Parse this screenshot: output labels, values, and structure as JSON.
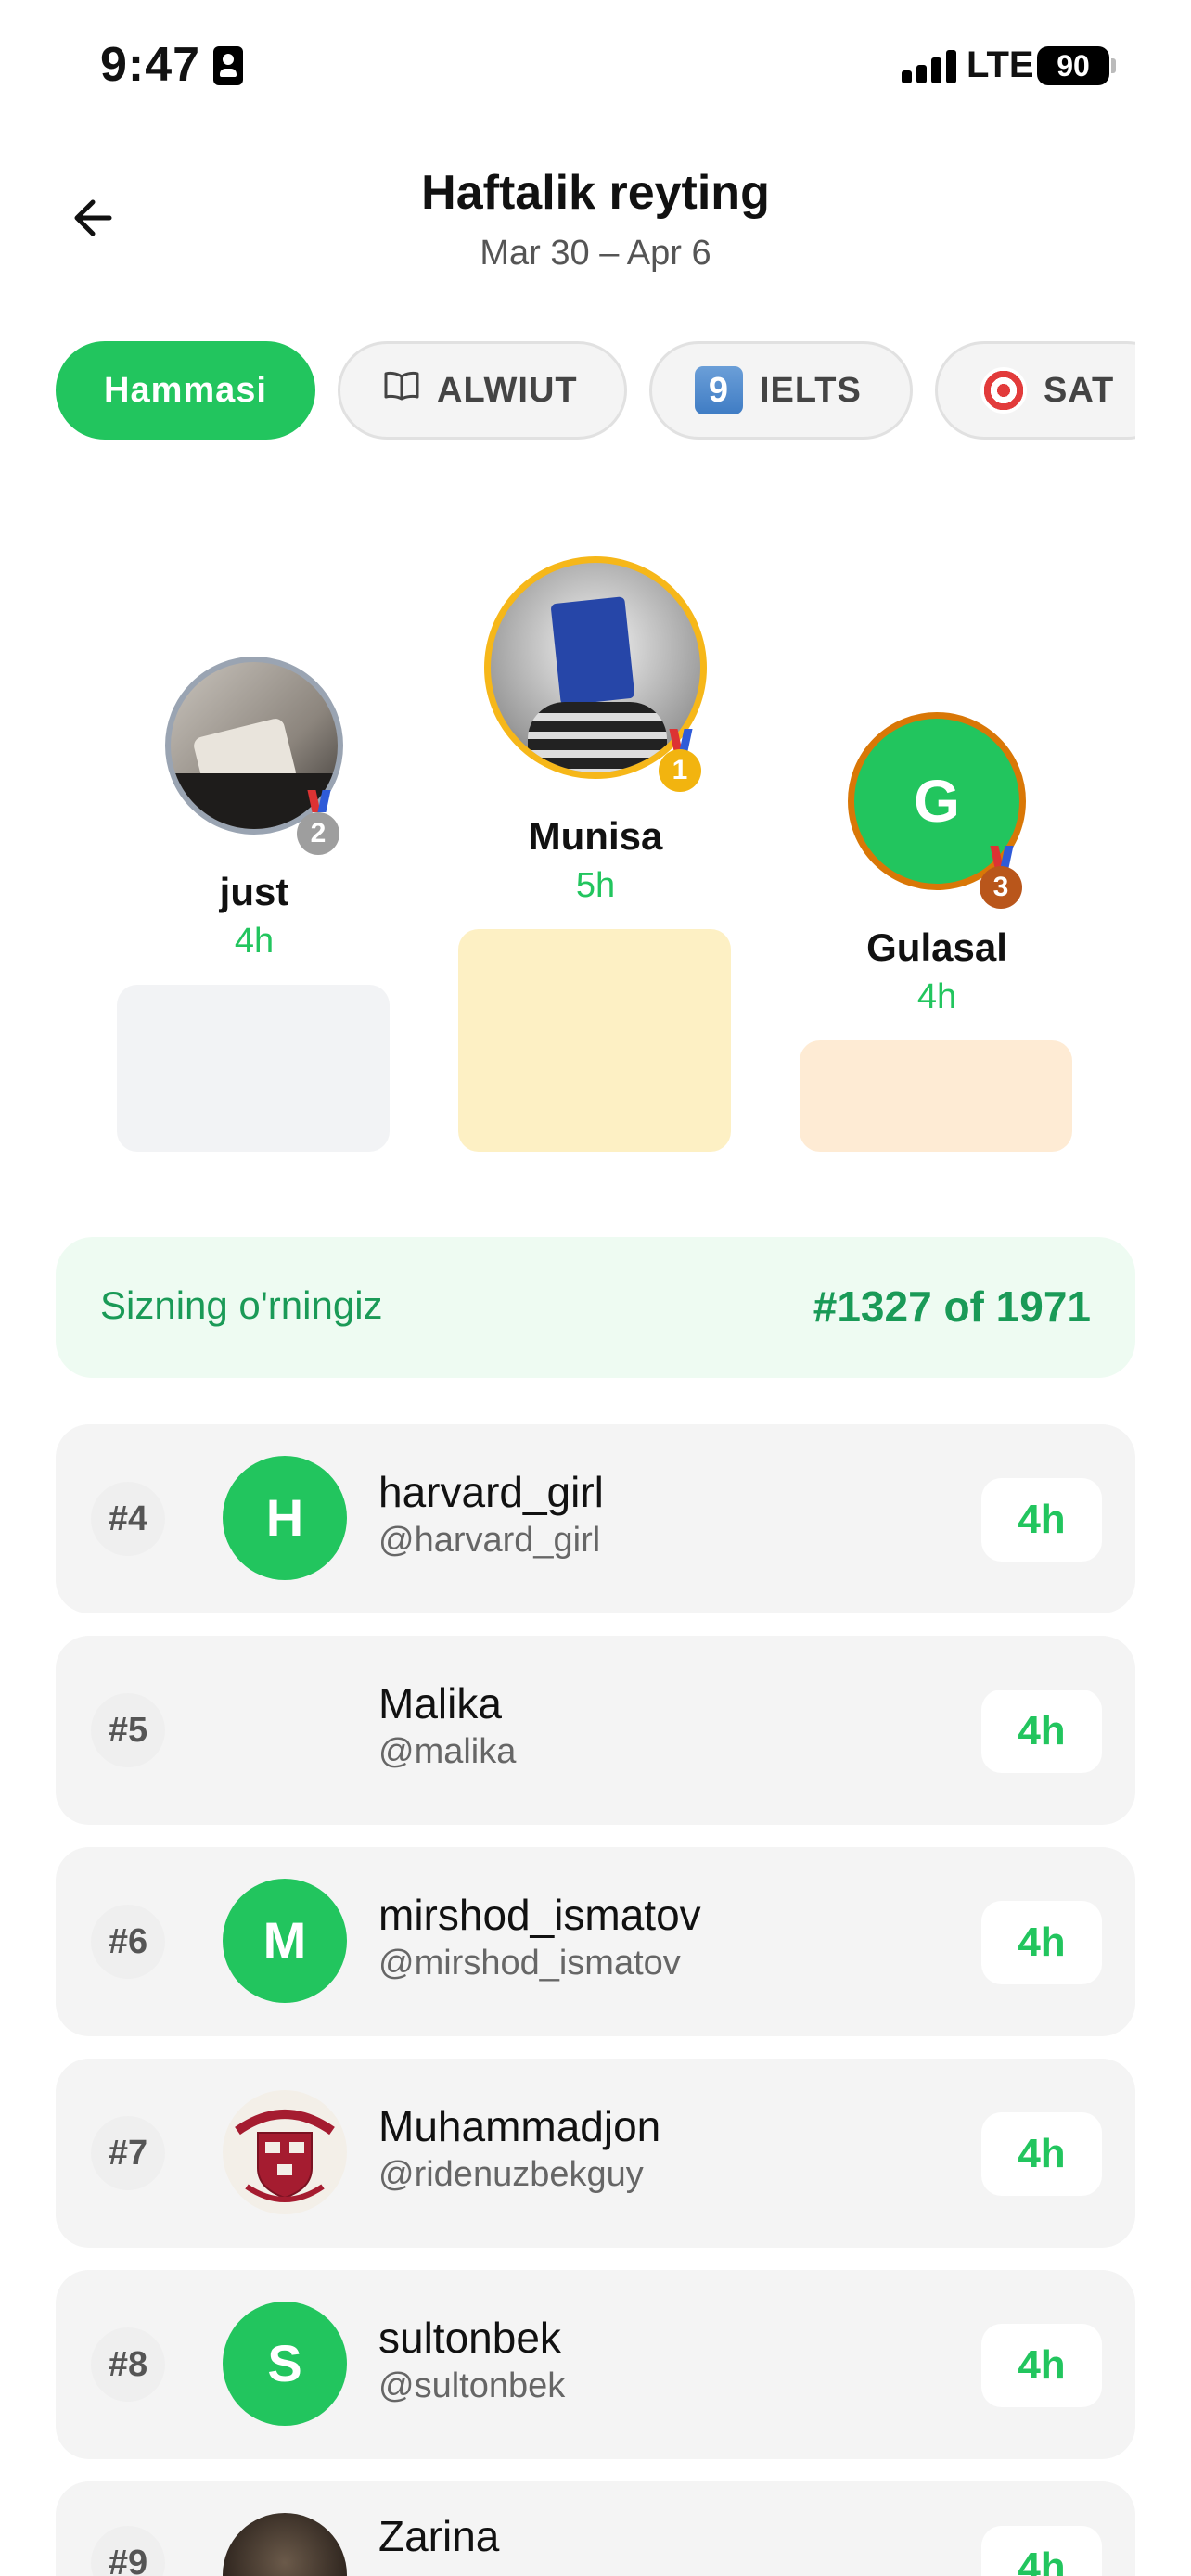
{
  "status_bar": {
    "time": "9:47",
    "network": "LTE",
    "battery": "90"
  },
  "header": {
    "title": "Haftalik reyting",
    "date_range": "Mar 30 – Apr 6"
  },
  "filters": [
    {
      "label": "Hammasi",
      "icon": "",
      "active": true
    },
    {
      "label": "ALWIUT",
      "icon": "book-icon",
      "active": false
    },
    {
      "label": "IELTS",
      "icon": "keycap-nine-icon",
      "active": false
    },
    {
      "label": "SAT",
      "icon": "target-icon",
      "active": false
    }
  ],
  "podium": [
    {
      "place": "1",
      "name": "Munisa",
      "score": "5h",
      "medal_color": "#f2b40f",
      "ring_color": "#f6b719",
      "block_color": "#fdf0c4"
    },
    {
      "place": "2",
      "name": "just",
      "score": "4h",
      "medal_color": "#9e9e9e",
      "ring_color": "#9aa4b2",
      "block_color": "#f2f3f5"
    },
    {
      "place": "3",
      "name": "Gulasal",
      "score": "4h",
      "initial": "G",
      "medal_color": "#b9561b",
      "ring_color": "#d97706",
      "block_color": "#feebd4"
    }
  ],
  "my_rank": {
    "label": "Sizning o'rningiz",
    "value": "#1327 of 1971"
  },
  "leaderboard": [
    {
      "rank": "#4",
      "name": "harvard_girl",
      "handle": "@harvard_girl",
      "score": "4h",
      "avatar": "H"
    },
    {
      "rank": "#5",
      "name": "Malika",
      "handle": "@malika",
      "score": "4h",
      "avatar": ""
    },
    {
      "rank": "#6",
      "name": "mirshod_ismatov",
      "handle": "@mirshod_ismatov",
      "score": "4h",
      "avatar": "M"
    },
    {
      "rank": "#7",
      "name": "Muhammadjon",
      "handle": "@ridenuzbekguy",
      "score": "4h",
      "avatar": "harvard-crest"
    },
    {
      "rank": "#8",
      "name": "sultonbek",
      "handle": "@sultonbek",
      "score": "4h",
      "avatar": "S"
    },
    {
      "rank": "#9",
      "name": "Zarina",
      "handle": "",
      "score": "4h",
      "avatar": "photo"
    }
  ],
  "colors": {
    "accent": "#22c55e",
    "accent_dark": "#1a9a57"
  }
}
